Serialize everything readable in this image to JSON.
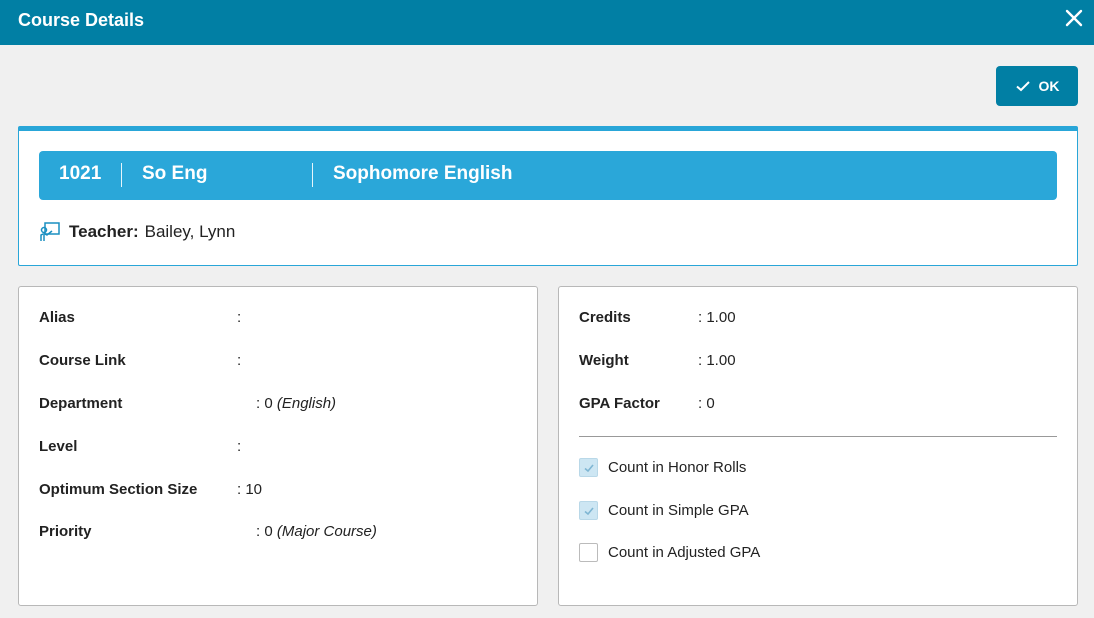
{
  "window": {
    "title": "Course Details",
    "close_icon": "close-icon"
  },
  "toolbar": {
    "ok_label": "OK",
    "ok_icon": "check-icon"
  },
  "course": {
    "number": "1021",
    "short_name": "So Eng",
    "full_name": "Sophomore English",
    "teacher_label": "Teacher:",
    "teacher_name": "Bailey, Lynn",
    "teacher_icon": "teacher-icon"
  },
  "details": {
    "alias": {
      "label": "Alias",
      "value": "",
      "note": ""
    },
    "course_link": {
      "label": "Course Link",
      "value": "",
      "note": ""
    },
    "department": {
      "label": "Department",
      "value": "0",
      "note": "(English)"
    },
    "level": {
      "label": "Level",
      "value": "",
      "note": ""
    },
    "optimum_section_size": {
      "label": "Optimum Section Size",
      "value": "10",
      "note": ""
    },
    "priority": {
      "label": "Priority",
      "value": "0",
      "note": "(Major Course)"
    }
  },
  "grading": {
    "credits": {
      "label": "Credits",
      "value": "1.00"
    },
    "weight": {
      "label": "Weight",
      "value": "1.00"
    },
    "gpa_factor": {
      "label": "GPA Factor",
      "value": "0"
    }
  },
  "flags": [
    {
      "label": "Count in Honor Rolls",
      "checked": true
    },
    {
      "label": "Count in Simple GPA",
      "checked": true
    },
    {
      "label": "Count in Adjusted GPA",
      "checked": false
    }
  ],
  "colors": {
    "header": "#017fa4",
    "banner": "#2aa7d9",
    "checkbox_checked": "#cde6f3"
  }
}
